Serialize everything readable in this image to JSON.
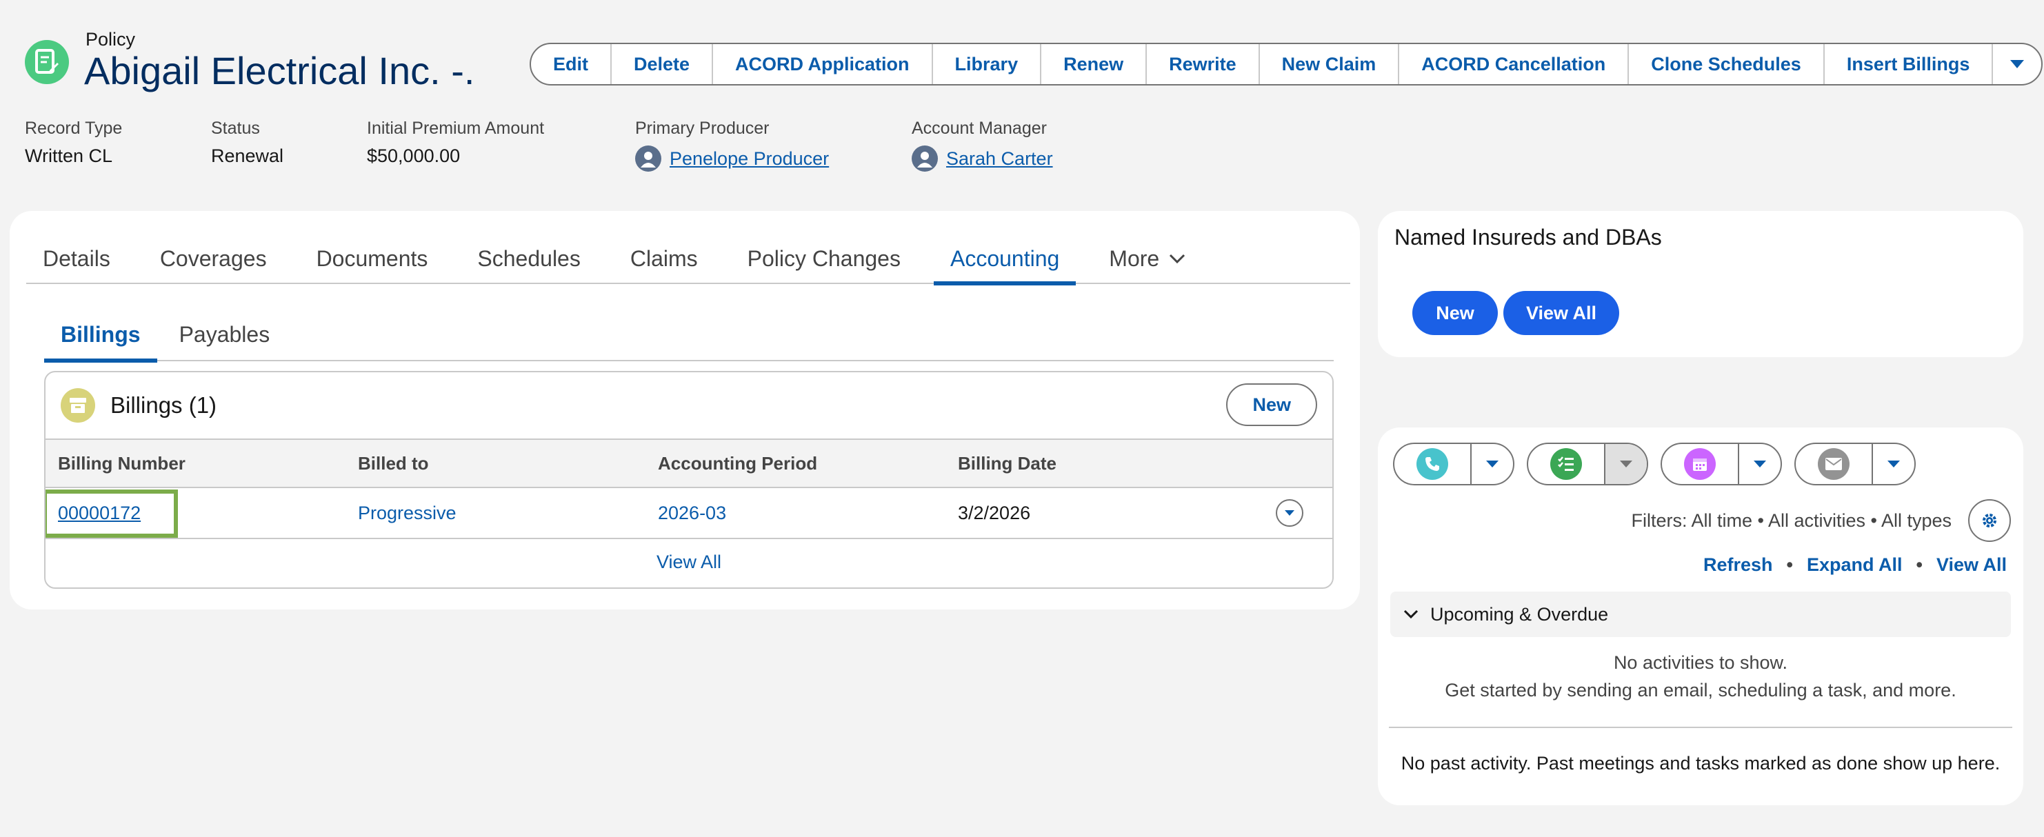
{
  "header": {
    "object_label": "Policy",
    "record_title": "Abigail Electrical Inc. -...",
    "actions": [
      "Edit",
      "Delete",
      "ACORD Application",
      "Library",
      "Renew",
      "Rewrite",
      "New Claim",
      "ACORD Cancellation",
      "Clone Schedules",
      "Insert Billings"
    ],
    "highlights": {
      "record_type": {
        "label": "Record Type",
        "value": "Written CL"
      },
      "status": {
        "label": "Status",
        "value": "Renewal"
      },
      "premium": {
        "label": "Initial Premium Amount",
        "value": "$50,000.00"
      },
      "producer": {
        "label": "Primary Producer",
        "value": "Penelope Producer"
      },
      "manager": {
        "label": "Account Manager",
        "value": "Sarah Carter"
      }
    }
  },
  "tabs": [
    "Details",
    "Coverages",
    "Documents",
    "Schedules",
    "Claims",
    "Policy Changes",
    "Accounting",
    "More"
  ],
  "subtabs": [
    "Billings",
    "Payables"
  ],
  "billings": {
    "title": "Billings (1)",
    "new_label": "New",
    "columns": [
      "Billing Number",
      "Billed to",
      "Accounting Period",
      "Billing Date"
    ],
    "rows": [
      {
        "number": "00000172",
        "billed_to": "Progressive",
        "period": "2026-03",
        "date": "3/2/2026"
      }
    ],
    "view_all": "View All"
  },
  "named": {
    "title": "Named Insureds and DBAs",
    "new_label": "New",
    "view_all_label": "View All"
  },
  "activity": {
    "filters": "Filters: All time • All activities • All types",
    "refresh": "Refresh",
    "expand_all": "Expand All",
    "view_all": "View All",
    "sep": "•",
    "upcoming": "Upcoming & Overdue",
    "no_activities": "No activities to show.",
    "get_started": "Get started by sending an email, scheduling a task, and more.",
    "past": "No past activity. Past meetings and tasks marked as done show up here."
  },
  "colors": {
    "brand": "#0b5cab",
    "primary_button": "#1b60e6",
    "policy_icon": "#4bca81",
    "focus_outline": "#7cac4a"
  }
}
